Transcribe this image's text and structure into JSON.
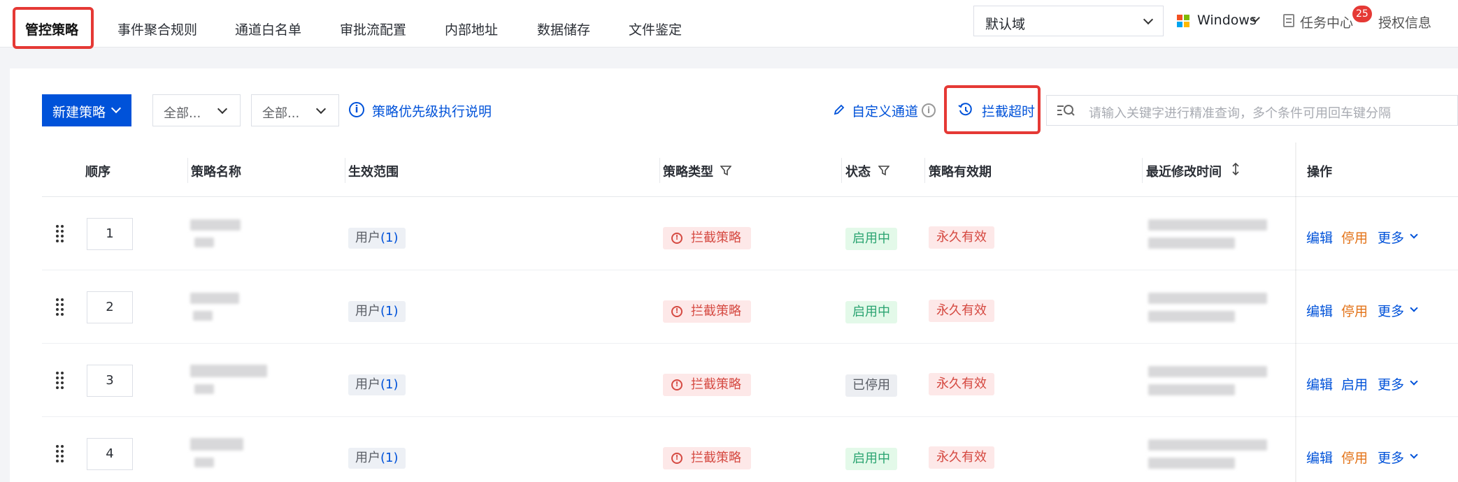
{
  "nav": {
    "tabs": [
      "管控策略",
      "事件聚合规则",
      "通道白名单",
      "审批流配置",
      "内部地址",
      "数据储存",
      "文件鉴定"
    ],
    "domain_select": "默认域",
    "os": "Windows",
    "task_center": "任务中心",
    "task_badge": "25",
    "auth_info": "授权信息"
  },
  "toolbar": {
    "new_policy": "新建策略",
    "filter1": "全部...",
    "filter2": "全部...",
    "priority_link": "策略优先级执行说明",
    "custom_channel": "自定义通道",
    "block_timeout": "拦截超时",
    "search_placeholder": "请输入关键字进行精准查询，多个条件可用回车键分隔"
  },
  "table": {
    "headers": {
      "order": "顺序",
      "name": "策略名称",
      "scope": "生效范围",
      "type": "策略类型",
      "status": "状态",
      "validity": "策略有效期",
      "modified": "最近修改时间",
      "ops": "操作"
    },
    "rows": [
      {
        "order": "1",
        "scope_label": "用户",
        "scope_count": "(1)",
        "type": "拦截策略",
        "status": "启用中",
        "validity": "永久有效",
        "ops": [
          "编辑",
          "停用",
          "更多"
        ]
      },
      {
        "order": "2",
        "scope_label": "用户",
        "scope_count": "(1)",
        "type": "拦截策略",
        "status": "启用中",
        "validity": "永久有效",
        "ops": [
          "编辑",
          "停用",
          "更多"
        ]
      },
      {
        "order": "3",
        "scope_label": "用户",
        "scope_count": "(1)",
        "type": "拦截策略",
        "status": "已停用",
        "validity": "永久有效",
        "ops": [
          "编辑",
          "启用",
          "更多"
        ]
      },
      {
        "order": "4",
        "scope_label": "用户",
        "scope_count": "(1)",
        "type": "拦截策略",
        "status": "启用中",
        "validity": "永久有效",
        "ops": [
          "编辑",
          "停用",
          "更多"
        ]
      }
    ]
  },
  "colors": {
    "primary": "#0052d9",
    "highlight": "#e53935",
    "danger": "#d54941",
    "success": "#2ba471",
    "warning": "#e37318"
  }
}
